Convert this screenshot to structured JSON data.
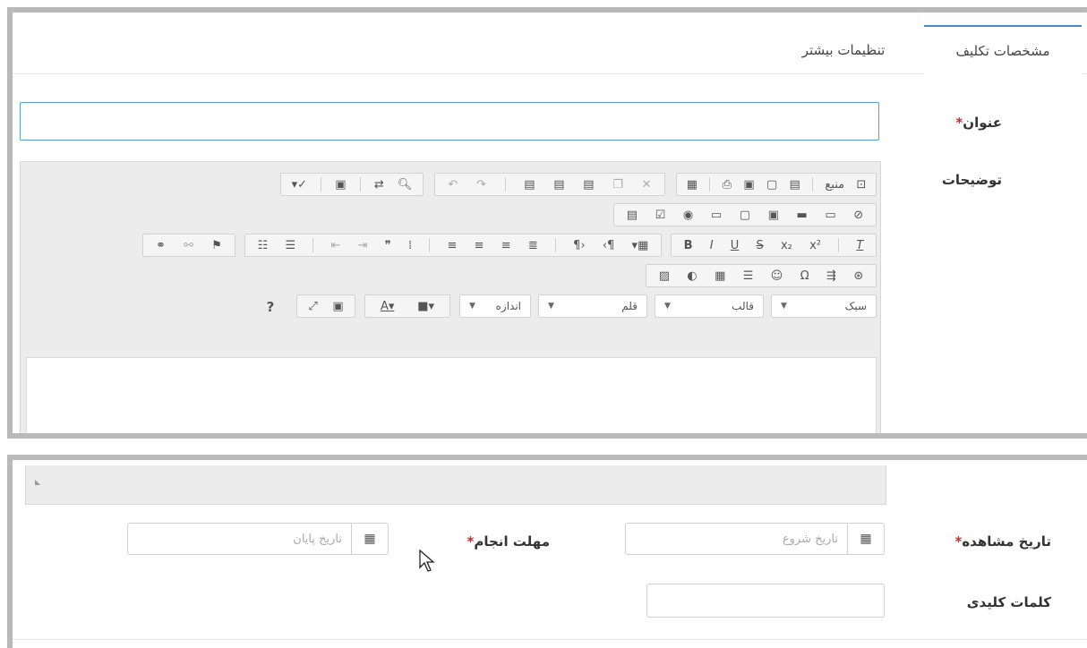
{
  "tabs": [
    {
      "label": "مشخصات تکلیف",
      "active": true
    },
    {
      "label": "تنظیمات بیشتر",
      "active": false
    }
  ],
  "form": {
    "title_label": "عنوان",
    "description_label": "توضیحات",
    "required_mark": "*",
    "view_date_label": "تاریخ مشاهده",
    "deadline_label": "مهلت انجام",
    "keywords_label": "کلمات کلیدی",
    "start_date_placeholder": "تاریخ شروع",
    "end_date_placeholder": "تاریخ پایان"
  },
  "editor": {
    "source_label": "منبع",
    "row3_combos": {
      "style": "سبک",
      "format": "قالب",
      "font": "قلم",
      "size": "اندازه"
    },
    "help": "?"
  },
  "colors": {
    "accent": "#4a86c9",
    "required": "#e02020",
    "frame": "#b9b9b9",
    "toolbar_bg": "#ececec"
  }
}
